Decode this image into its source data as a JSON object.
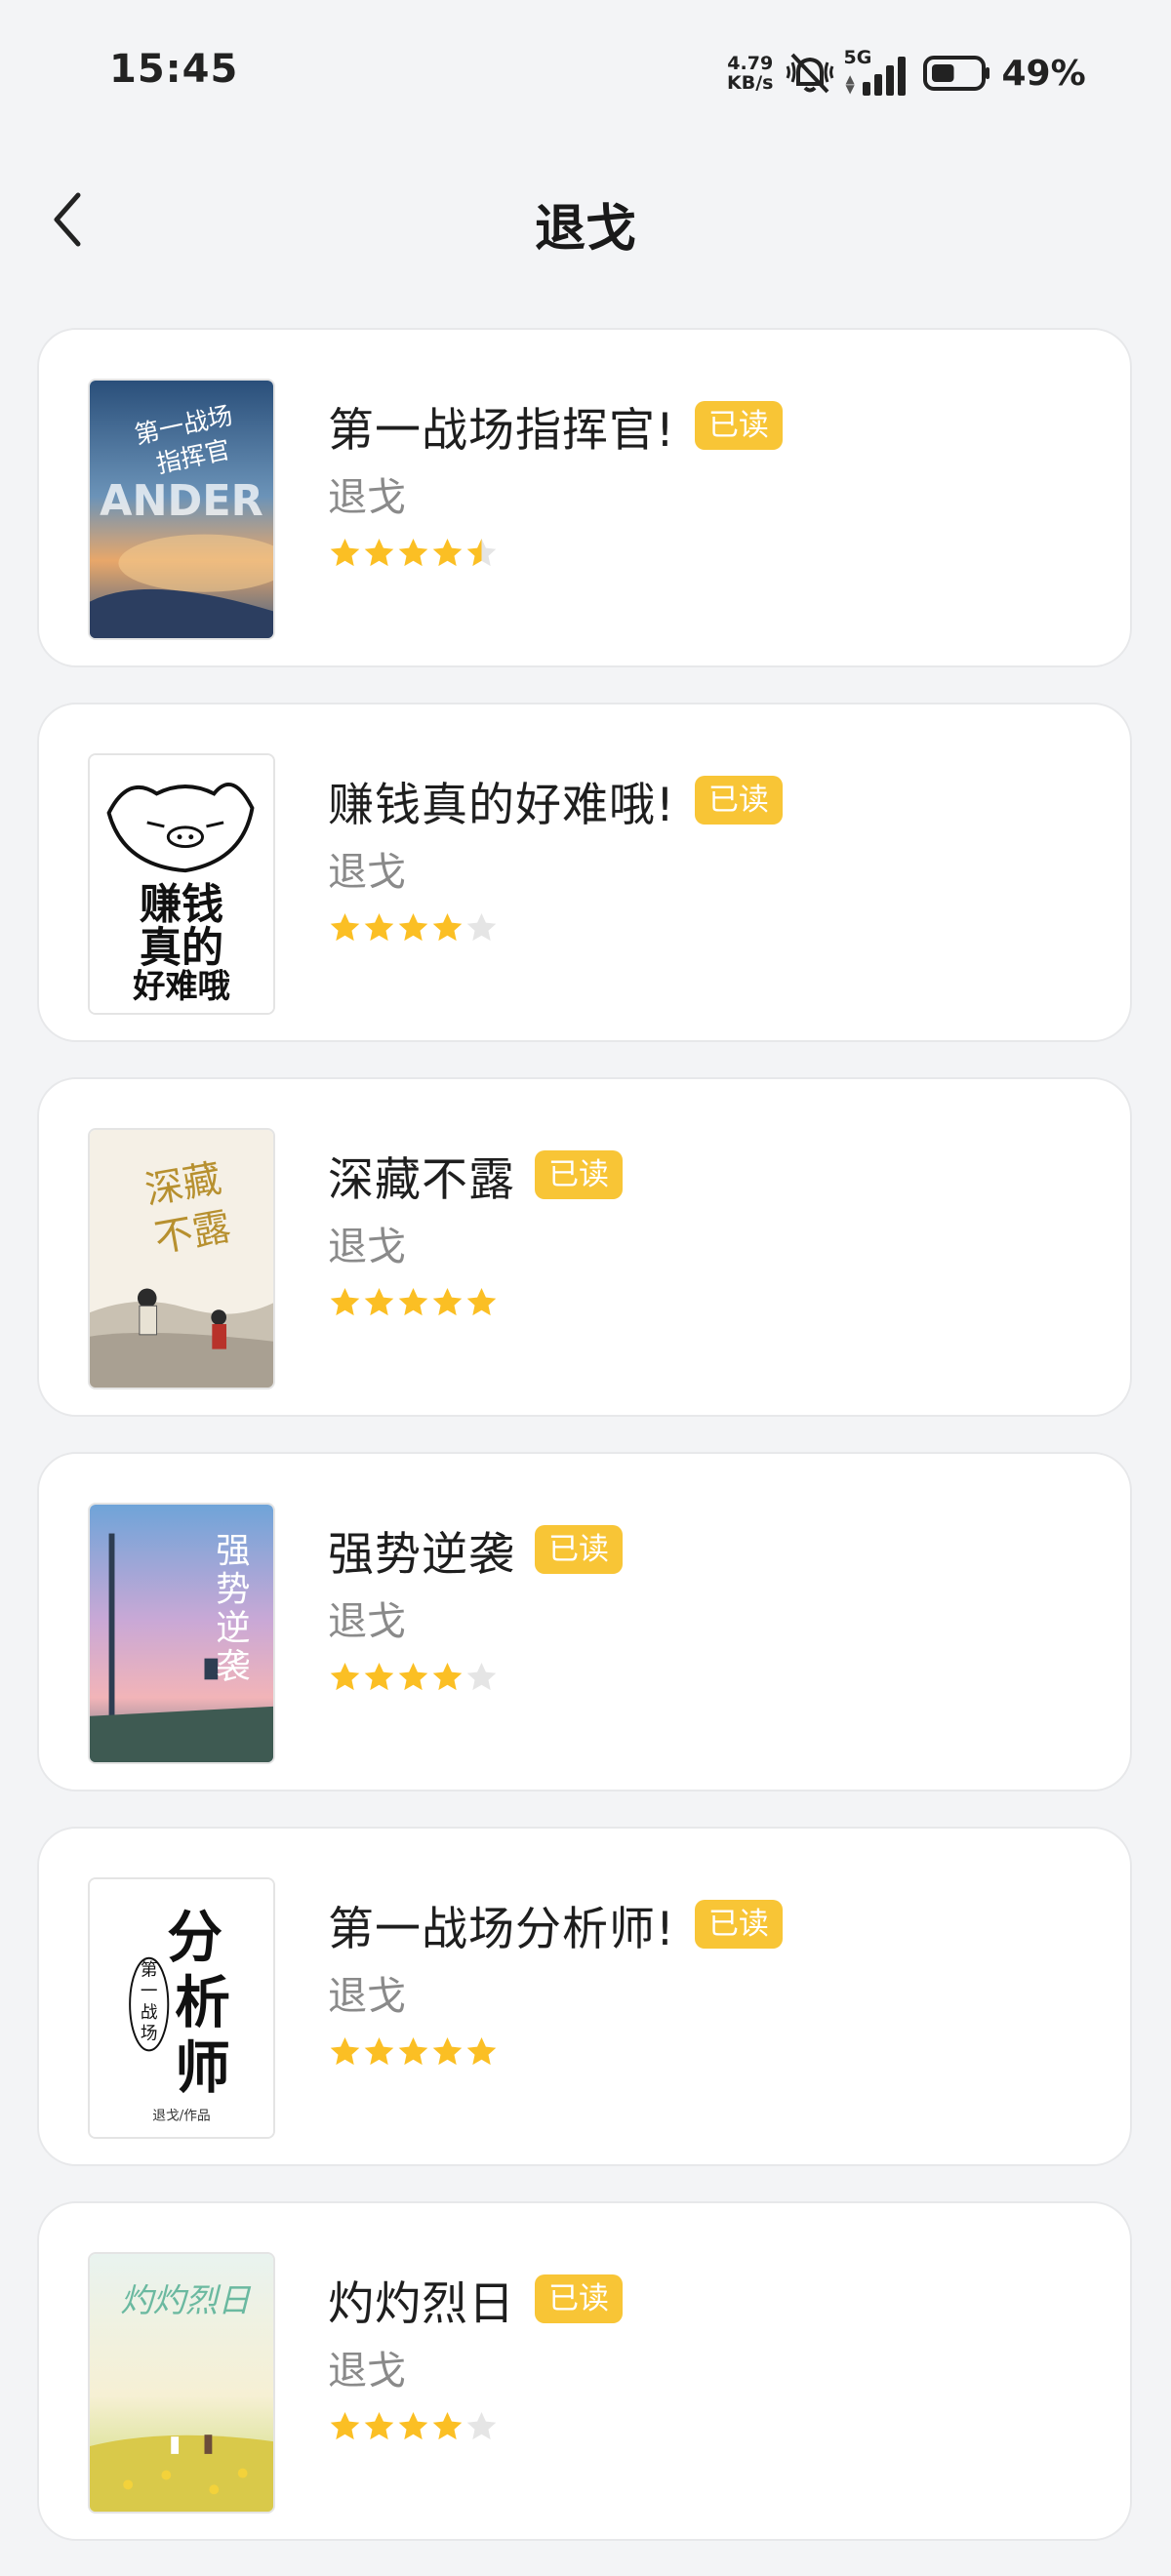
{
  "status_bar": {
    "time": "15:45",
    "net_speed_value": "4.79",
    "net_speed_unit": "KB/s",
    "network_type": "5G",
    "battery_percent": "49%",
    "battery_level": 0.49,
    "icons": [
      "mute-vibrate-off-icon",
      "signal-icon",
      "battery-icon"
    ]
  },
  "header": {
    "back_icon": "chevron-left-icon",
    "title": "退戈"
  },
  "colors": {
    "badge": "#f8c536",
    "star_filled": "#fbbf24",
    "star_empty": "#e5e5e5",
    "background": "#f3f4f6",
    "card": "#ffffff"
  },
  "books": [
    {
      "title": "第一战场指挥官!",
      "author": "退戈",
      "badge": "已读",
      "rating": 4.5,
      "cover_text": "第一战场 指挥官 ANDER"
    },
    {
      "title": "赚钱真的好难哦!",
      "author": "退戈",
      "badge": "已读",
      "rating": 4,
      "cover_text": "赚钱 真的 好难哦"
    },
    {
      "title": "深藏不露",
      "author": "退戈",
      "badge": "已读",
      "rating": 5,
      "cover_text": "深藏不露"
    },
    {
      "title": "强势逆袭",
      "author": "退戈",
      "badge": "已读",
      "rating": 4,
      "cover_text": "强势逆袭"
    },
    {
      "title": "第一战场分析师!",
      "author": "退戈",
      "badge": "已读",
      "rating": 5,
      "cover_text": "第一战场 分析师 退戈/作品"
    },
    {
      "title": "灼灼烈日",
      "author": "退戈",
      "badge": "已读",
      "rating": 4,
      "cover_text": "灼灼烈日"
    }
  ]
}
